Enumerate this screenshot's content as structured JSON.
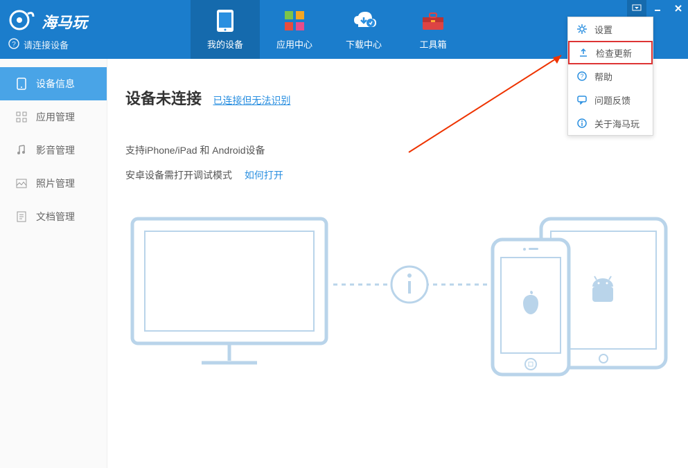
{
  "brand": {
    "title": "海马玩",
    "subtitle": "请连接设备"
  },
  "tabs": [
    {
      "label": "我的设备"
    },
    {
      "label": "应用中心"
    },
    {
      "label": "下载中心"
    },
    {
      "label": "工具箱"
    }
  ],
  "sidebar": [
    {
      "label": "设备信息"
    },
    {
      "label": "应用管理"
    },
    {
      "label": "影音管理"
    },
    {
      "label": "照片管理"
    },
    {
      "label": "文档管理"
    }
  ],
  "main": {
    "heading": "设备未连接",
    "heading_link": "已连接但无法识别",
    "line1": "支持iPhone/iPad 和 Android设备",
    "line2": "安卓设备需打开调试模式",
    "line2_link": "如何打开"
  },
  "menu": [
    {
      "label": "设置"
    },
    {
      "label": "检查更新"
    },
    {
      "label": "帮助"
    },
    {
      "label": "问题反馈"
    },
    {
      "label": "关于海马玩"
    }
  ]
}
